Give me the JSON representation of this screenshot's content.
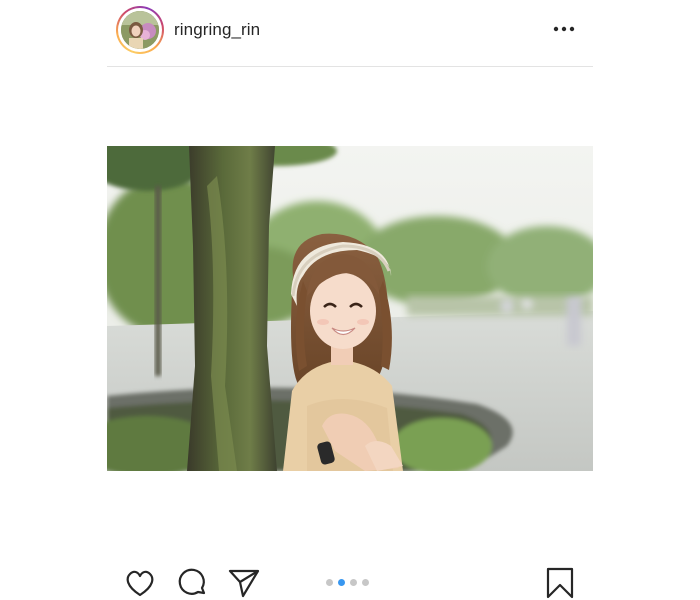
{
  "header": {
    "username": "ringring_rin",
    "avatar_icon": "profile-photo",
    "more_icon": "more-options-icon"
  },
  "post": {
    "image_description_icon": "photo",
    "carousel": {
      "total": 4,
      "active_index": 1
    }
  },
  "actions": {
    "like_icon": "heart-icon",
    "comment_icon": "comment-icon",
    "share_icon": "send-icon",
    "save_icon": "bookmark-icon"
  },
  "colors": {
    "active_dot": "#3897f0",
    "inactive_dot": "#c7c7c7",
    "text": "#262626"
  }
}
